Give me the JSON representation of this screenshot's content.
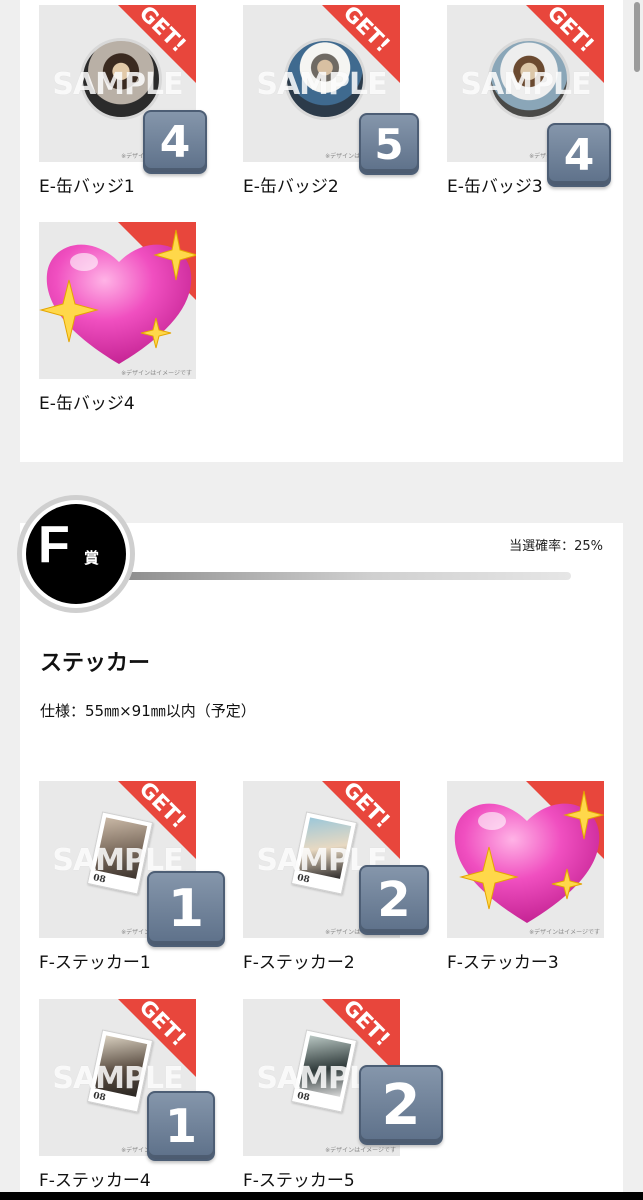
{
  "e_section": {
    "items": [
      {
        "label": "E-缶バッジ1",
        "count": "4",
        "get": "GET!",
        "watermark": "SAMPLE",
        "note": "※デザインはイメージです"
      },
      {
        "label": "E-缶バッジ2",
        "count": "5",
        "get": "GET!",
        "watermark": "SAMPLE",
        "note": "※デザインはイメージです"
      },
      {
        "label": "E-缶バッジ3",
        "count": "4",
        "get": "GET!",
        "watermark": "SAMPLE",
        "note": "※デザインはイメージです"
      },
      {
        "label": "E-缶バッジ4",
        "note": "※デザインはイメージです"
      }
    ]
  },
  "f_section": {
    "award_letter": "F",
    "award_suffix": "賞",
    "probability": "当選確率：25%",
    "title": "ステッカー",
    "spec": "仕様：55㎜×91㎜以内（予定）",
    "items": [
      {
        "label": "F-ステッカー1",
        "count": "1",
        "get": "GET!",
        "watermark": "SAMPLE",
        "note": "※デザインはイメージです",
        "sticker_num": "08"
      },
      {
        "label": "F-ステッカー2",
        "count": "2",
        "get": "GET!",
        "watermark": "SAMPLE",
        "note": "※デザインはイメージです",
        "sticker_num": "08"
      },
      {
        "label": "F-ステッカー3",
        "note": "※デザインはイメージです"
      },
      {
        "label": "F-ステッカー4",
        "count": "1",
        "get": "GET!",
        "watermark": "SAMPLE",
        "note": "※デザインはイメージです",
        "sticker_num": "08"
      },
      {
        "label": "F-ステッカー5",
        "count": "2",
        "get": "GET!",
        "watermark": "SAMPLE",
        "note": "※デザインはイメージです",
        "sticker_num": "08"
      }
    ]
  },
  "colors": {
    "get_ribbon": "#e8463c",
    "keycap": "#6f819a",
    "progress": "#bdbdbd"
  },
  "icons": [
    "heart-sparkle-icon",
    "keycap-number-icon",
    "get-ribbon-icon"
  ]
}
